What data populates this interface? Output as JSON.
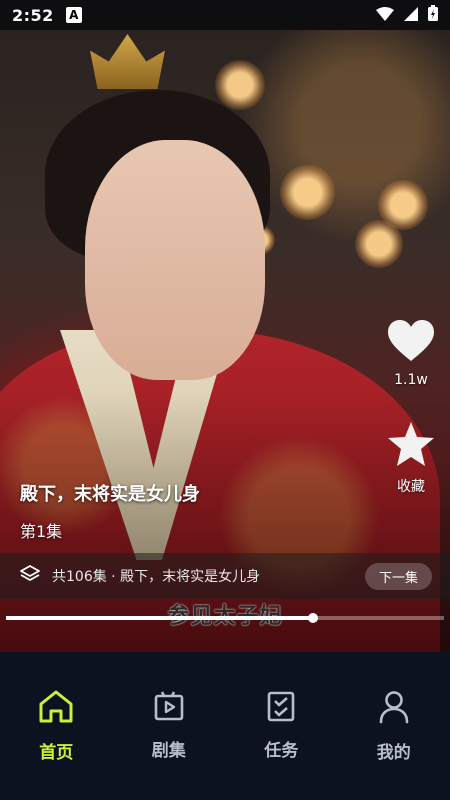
{
  "status_bar": {
    "time": "2:52",
    "notification_badge": "A",
    "icons": [
      "wifi-icon",
      "signal-icon",
      "battery-charging-icon"
    ]
  },
  "video": {
    "drama_title": "殿下，末将实是女儿身",
    "episode": "第1集",
    "subtitle": "参见太子妃",
    "progress_fraction": 0.7
  },
  "actions": {
    "like": {
      "icon": "heart-icon",
      "count": "1.1w"
    },
    "favorite": {
      "icon": "star-icon",
      "label": "收藏"
    }
  },
  "collection_bar": {
    "icon": "layers-icon",
    "text": "共106集 · 殿下，末将实是女儿身",
    "next_label": "下一集"
  },
  "bottom_nav": {
    "items": [
      {
        "label": "首页",
        "icon": "home-icon",
        "active": true
      },
      {
        "label": "剧集",
        "icon": "episodes-icon",
        "active": false
      },
      {
        "label": "任务",
        "icon": "task-icon",
        "active": false
      },
      {
        "label": "我的",
        "icon": "profile-icon",
        "active": false
      }
    ]
  },
  "colors": {
    "accent": "#c8f23c",
    "nav_background": "#0b1220",
    "nav_inactive": "#b9bec8"
  }
}
